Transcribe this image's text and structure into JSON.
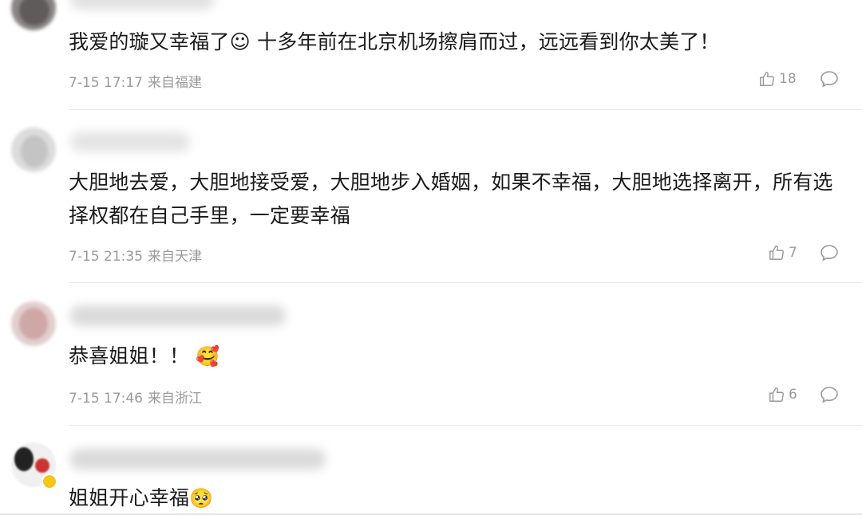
{
  "comments": [
    {
      "text": "我爱的璇又幸福了☺ 十多年前在北京机场擦肩而过，远远看到你太美了！",
      "time": "7-15 17:17",
      "location": "来自福建",
      "likes": "18",
      "avatar_colors": [
        "#6b6b6b",
        "#b9b0b0"
      ]
    },
    {
      "text": "大胆地去爱，大胆地接受爱，大胆地步入婚姻，如果不幸福，大胆地选择离开，所有选择权都在自己手里，一定要幸福",
      "time": "7-15 21:35",
      "location": "来自天津",
      "likes": "7",
      "avatar_colors": [
        "#cfcfcf",
        "#e8e8e8"
      ]
    },
    {
      "text": "恭喜姐姐！！",
      "emoji": "🥰",
      "time": "7-15 17:46",
      "location": "来自浙江",
      "likes": "6",
      "avatar_colors": [
        "#c9a9a9",
        "#ead9d9"
      ]
    },
    {
      "text": "姐姐开心幸福",
      "emoji": "🥺",
      "avatar_colors": [
        "#2a2a2a",
        "#eeeeee"
      ]
    }
  ]
}
